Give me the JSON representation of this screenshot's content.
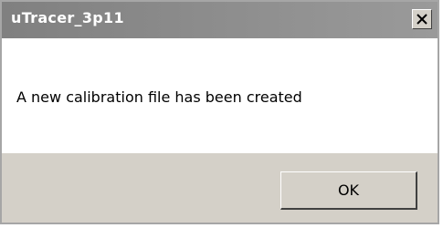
{
  "window": {
    "title": "uTracer_3p11"
  },
  "message": {
    "text": "A new calibration file has been created"
  },
  "buttons": {
    "ok_label": "OK"
  },
  "icons": {
    "close": "close-icon"
  },
  "colors": {
    "titlebar": "#8a8a8a",
    "title_text": "#ffffff",
    "dialog_bg": "#d4d0c8",
    "content_bg": "#ffffff"
  }
}
